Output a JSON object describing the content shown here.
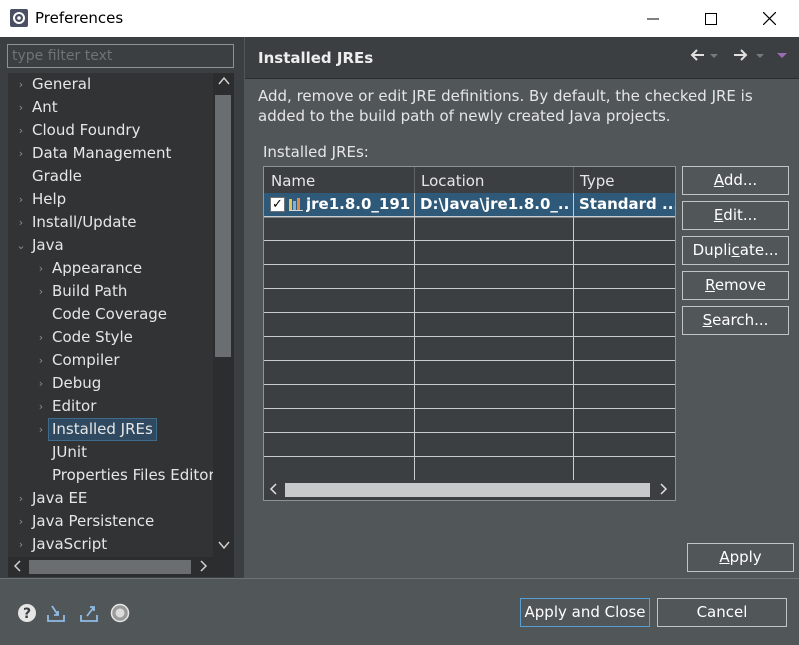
{
  "window": {
    "title": "Preferences"
  },
  "filter": {
    "placeholder": "type filter text"
  },
  "tree": {
    "items": [
      {
        "label": "General",
        "arrow": "›"
      },
      {
        "label": "Ant",
        "arrow": "›"
      },
      {
        "label": "Cloud Foundry",
        "arrow": "›"
      },
      {
        "label": "Data Management",
        "arrow": "›"
      },
      {
        "label": "Gradle",
        "arrow": ""
      },
      {
        "label": "Help",
        "arrow": "›"
      },
      {
        "label": "Install/Update",
        "arrow": "›"
      },
      {
        "label": "Java",
        "arrow": "⌄"
      },
      {
        "label": "Appearance",
        "arrow": "›"
      },
      {
        "label": "Build Path",
        "arrow": "›"
      },
      {
        "label": "Code Coverage",
        "arrow": ""
      },
      {
        "label": "Code Style",
        "arrow": "›"
      },
      {
        "label": "Compiler",
        "arrow": "›"
      },
      {
        "label": "Debug",
        "arrow": "›"
      },
      {
        "label": "Editor",
        "arrow": "›"
      },
      {
        "label": "Installed JREs",
        "arrow": "›"
      },
      {
        "label": "JUnit",
        "arrow": ""
      },
      {
        "label": "Properties Files Editor",
        "arrow": ""
      },
      {
        "label": "Java EE",
        "arrow": "›"
      },
      {
        "label": "Java Persistence",
        "arrow": "›"
      },
      {
        "label": "JavaScript",
        "arrow": "›"
      }
    ]
  },
  "panel": {
    "title": "Installed JREs",
    "description": "Add, remove or edit JRE definitions. By default, the checked JRE is added to the build path of newly created Java projects.",
    "table_label": "Installed JREs:",
    "columns": [
      "Name",
      "Location",
      "Type"
    ],
    "rows": [
      {
        "checked": true,
        "name": "jre1.8.0_191...",
        "location": "D:\\Java\\jre1.8.0_...",
        "type": "Standard ..."
      }
    ],
    "buttons": {
      "add": {
        "pre": "",
        "mnemonic": "A",
        "post": "dd..."
      },
      "edit": {
        "pre": "",
        "mnemonic": "E",
        "post": "dit..."
      },
      "duplicate": {
        "pre": "Dupli",
        "mnemonic": "c",
        "post": "ate..."
      },
      "remove": {
        "pre": "",
        "mnemonic": "R",
        "post": "emove"
      },
      "search": {
        "pre": "",
        "mnemonic": "S",
        "post": "earch..."
      }
    },
    "apply": {
      "pre": "",
      "mnemonic": "A",
      "post": "pply"
    }
  },
  "footer": {
    "apply_close": "Apply and Close",
    "cancel": "Cancel"
  },
  "colors": {
    "dark_bg": "#3c3f41",
    "pane_bg": "#515658",
    "selection": "#2f5979"
  }
}
